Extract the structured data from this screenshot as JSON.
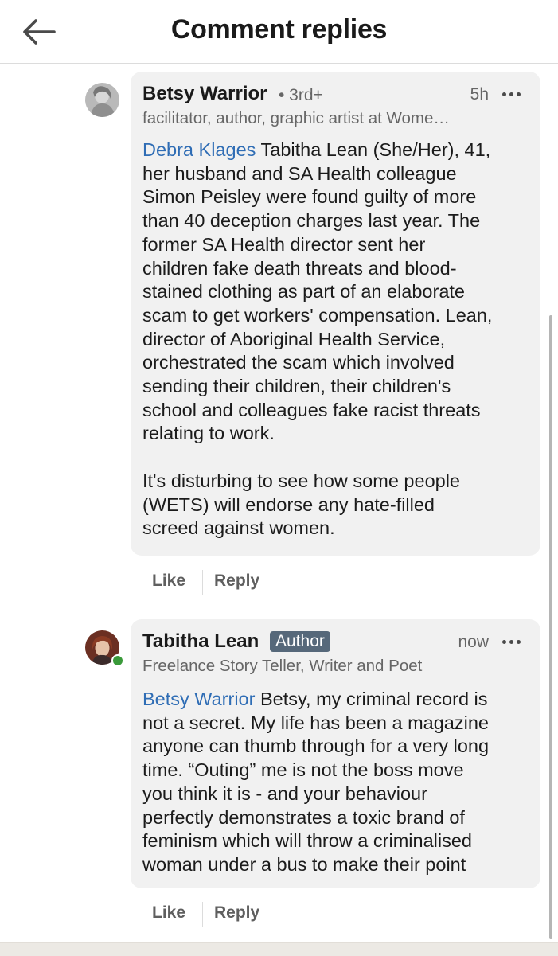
{
  "header": {
    "title": "Comment replies"
  },
  "comments": [
    {
      "author_name": "Betsy Warrior",
      "degree": "• 3rd+",
      "time": "5h",
      "headline": "facilitator, author, graphic artist at Wome…",
      "mention": "Debra Klages",
      "lines": [
        " Tabitha Lean (She/Her), 41,",
        "her husband and SA Health colleague",
        "Simon Peisley were found guilty of more",
        "than 40 deception charges last year. The",
        "former SA Health director sent her",
        "children fake death threats and blood-",
        "stained clothing as part of an elaborate",
        "scam to get workers' compensation. Lean,",
        "director of Aboriginal Health Service,",
        "orchestrated the scam which involved",
        "sending their children, their children's",
        "school and colleagues fake racist threats",
        "relating to work.",
        "",
        "It's disturbing to see how some people",
        "(WETS) will endorse any hate-filled",
        "screed against women."
      ],
      "like_label": "Like",
      "reply_label": "Reply"
    },
    {
      "author_name": "Tabitha Lean",
      "badge": "Author",
      "time": "now",
      "headline": "Freelance Story Teller, Writer and Poet",
      "mention": "Betsy Warrior",
      "lines": [
        " Betsy, my criminal record is",
        "not a secret. My life has been a magazine",
        "anyone can thumb through for a very long",
        "time. “Outing” me is not the boss move",
        "you think it is - and your behaviour",
        "perfectly demonstrates a toxic brand of",
        "feminism which will throw a criminalised",
        "woman under a bus to make their point"
      ],
      "like_label": "Like",
      "reply_label": "Reply"
    }
  ],
  "icons": {
    "back": "arrow-left-icon",
    "more": "more-horizontal-icon"
  },
  "colors": {
    "mention": "#2f6db5",
    "bubble": "#f1f1f1",
    "badge": "#56687a",
    "presence": "#3a9a3a"
  }
}
